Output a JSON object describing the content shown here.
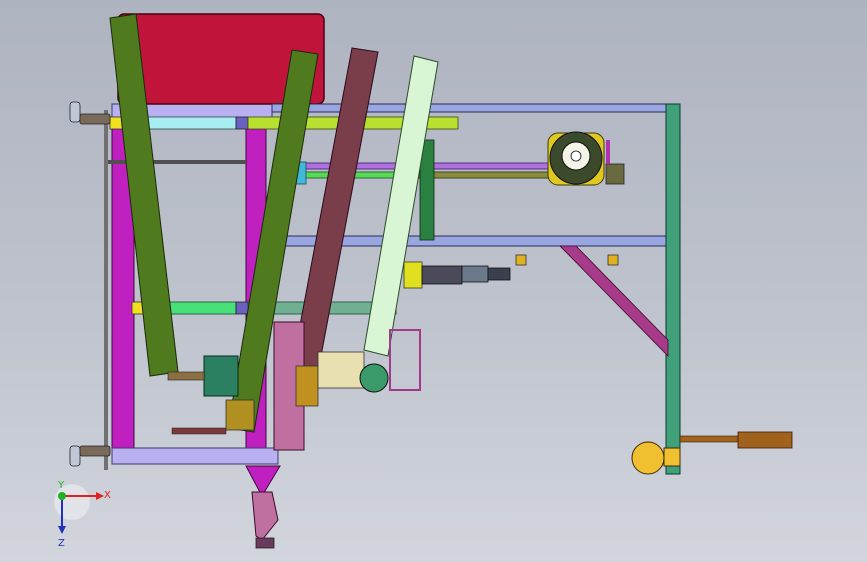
{
  "viewport": {
    "background_top": "#aeb3c0",
    "background_bottom": "#d2d5dc"
  },
  "triad": {
    "x_label": "X",
    "y_label": "Y",
    "z_label": "Z",
    "x_color": "#e02020",
    "y_color": "#20b020",
    "z_color": "#2030c0"
  },
  "model": {
    "colors": {
      "frame_purple": "#b8b0f0",
      "frame_magenta": "#c020c0",
      "box_red": "#c0143a",
      "beam_olive": "#4f7a1e",
      "beam_brown": "#7a3e4a",
      "beam_pale_green": "#d8f5d4",
      "cyan_bar": "#a8eef0",
      "lime_bar": "#b8e030",
      "rail_blue": "#9aa6e0",
      "post_teal": "#3fa07a",
      "shaft_bronze": "#a0621c",
      "bulb_yellow": "#f0c030"
    }
  }
}
